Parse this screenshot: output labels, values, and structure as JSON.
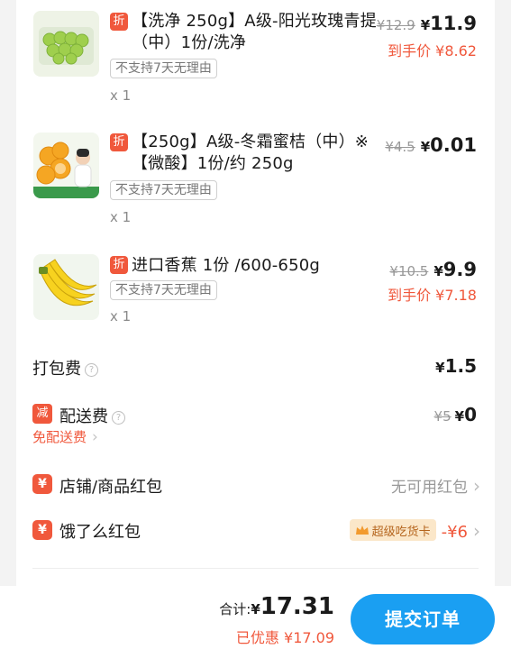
{
  "items": [
    {
      "discount_mark": "折",
      "title": "【洗净 250g】A级-阳光玫瑰青提（中）1份/洗净",
      "tag": "不支持7天无理由",
      "qty": "x 1",
      "old_price": "¥12.9",
      "price_symbol": "¥",
      "price": "11.9",
      "hand_price": "到手价 ¥8.62",
      "image_icon": "green-grapes-image"
    },
    {
      "discount_mark": "折",
      "title": "【250g】A级-冬霜蜜桔（中）※【微酸】1份/约 250g",
      "tag": "不支持7天无理由",
      "qty": "x 1",
      "old_price": "¥4.5",
      "price_symbol": "¥",
      "price": "0.01",
      "hand_price": "",
      "image_icon": "tangerine-image"
    },
    {
      "discount_mark": "折",
      "title": "进口香蕉 1份 /600-650g",
      "tag": "不支持7天无理由",
      "qty": "x 1",
      "old_price": "¥10.5",
      "price_symbol": "¥",
      "price": "9.9",
      "hand_price": "到手价 ¥7.18",
      "image_icon": "banana-image"
    }
  ],
  "packing": {
    "label": "打包费",
    "symbol": "¥",
    "value": "1.5"
  },
  "delivery": {
    "badge": "减",
    "label": "配送费",
    "old": "¥5",
    "symbol": "¥",
    "value": "0",
    "free_text": "免配送费"
  },
  "shop_packet": {
    "badge": "¥",
    "label": "店铺/商品红包",
    "value": "无可用红包"
  },
  "ele_packet": {
    "badge": "¥",
    "label": "饿了么红包",
    "chip": "超级吃货卡",
    "value": "-¥6"
  },
  "footer": {
    "total_label": "合计:",
    "total_symbol": "¥",
    "total_value": "17.31",
    "saved": "已优惠 ¥17.09",
    "submit": "提交订单"
  },
  "colors": {
    "accent_red": "#f0583c",
    "submit_blue": "#1a9ff2",
    "chip_bg": "#fbe7c9"
  }
}
